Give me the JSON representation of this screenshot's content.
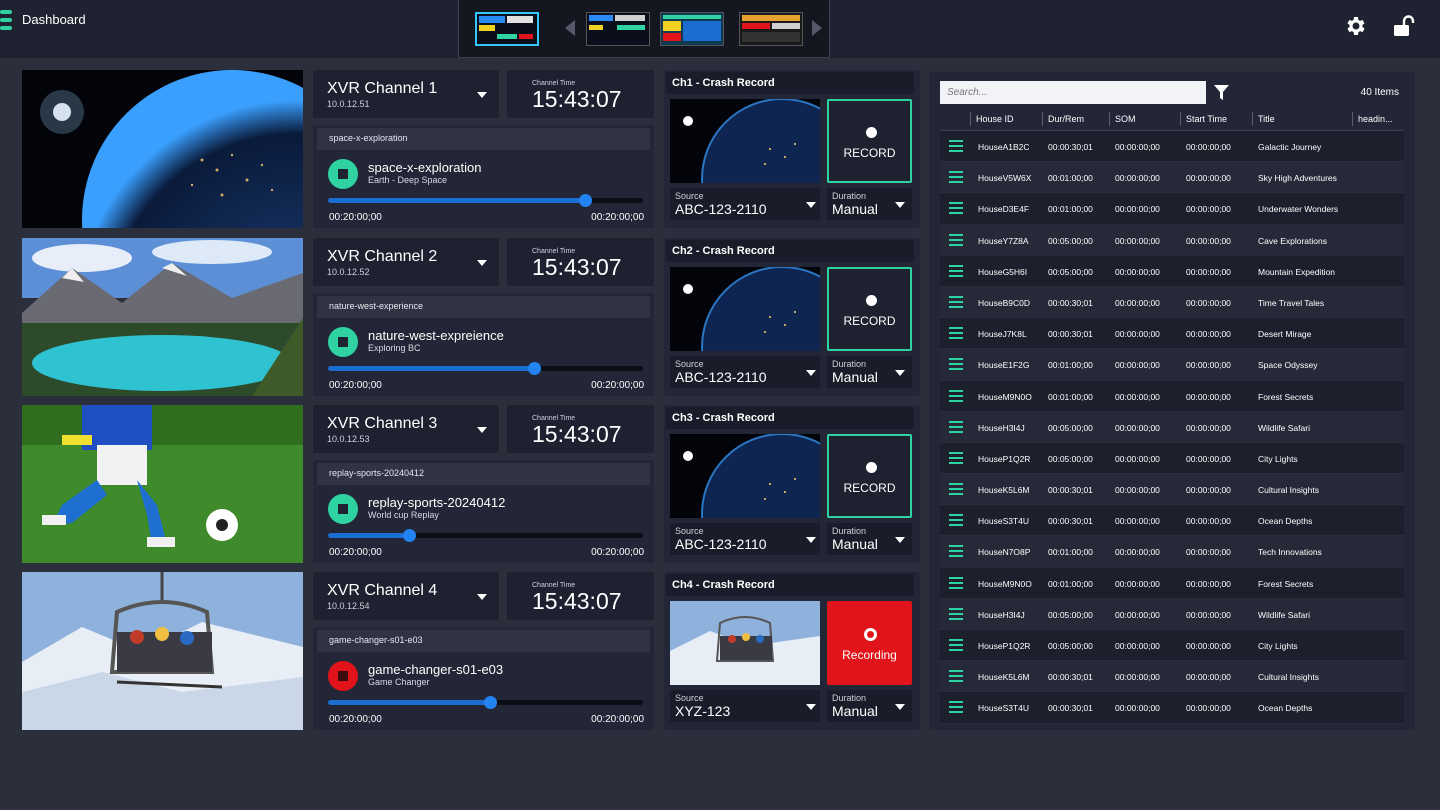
{
  "header": {
    "title": "Dashboard",
    "menu_icon": "hamburger-menu-icon",
    "settings_icon": "gear-icon",
    "lock_icon": "unlock-icon"
  },
  "colors": {
    "accent": "#2fd3a2",
    "record_red": "#e0141a",
    "progress_blue": "#1c6dd0",
    "background": "#2b2e3b"
  },
  "channels": [
    {
      "name": "XVR Channel 1",
      "ip": "10.0.12.51",
      "time_label": "Channel Time",
      "time": "15:43:07",
      "clip_tag": "space-x-exploration",
      "clip_title": "space-x-exploration",
      "clip_subtitle": "Earth - Deep Space",
      "progress": 0.815,
      "start": "00:20:00;00",
      "end": "00:20:00;00",
      "state": "ready",
      "rec_title": "Ch1 - Crash Record",
      "rec_label": "RECORD",
      "source_label": "Source",
      "source": "ABC-123-2110",
      "duration_label": "Duration",
      "duration": "Manual"
    },
    {
      "name": "XVR Channel 2",
      "ip": "10.0.12.52",
      "time_label": "Channel Time",
      "time": "15:43:07",
      "clip_tag": "nature-west-experience",
      "clip_title": "nature-west-expreience",
      "clip_subtitle": "Exploring BC",
      "progress": 0.655,
      "start": "00:20:00;00",
      "end": "00:20:00;00",
      "state": "ready",
      "rec_title": "Ch2 - Crash Record",
      "rec_label": "RECORD",
      "source_label": "Source",
      "source": "ABC-123-2110",
      "duration_label": "Duration",
      "duration": "Manual"
    },
    {
      "name": "XVR Channel 3",
      "ip": "10.0.12.53",
      "time_label": "Channel Time",
      "time": "15:43:07",
      "clip_tag": "replay-sports-20240412",
      "clip_title": "replay-sports-20240412",
      "clip_subtitle": "World cup Replay",
      "progress": 0.258,
      "start": "00:20:00;00",
      "end": "00:20:00;00",
      "state": "ready",
      "rec_title": "Ch3 - Crash Record",
      "rec_label": "RECORD",
      "source_label": "Source",
      "source": "ABC-123-2110",
      "duration_label": "Duration",
      "duration": "Manual"
    },
    {
      "name": "XVR Channel 4",
      "ip": "10.0.12.54",
      "time_label": "Channel Time",
      "time": "15:43:07",
      "clip_tag": "game-changer-s01-e03",
      "clip_title": "game-changer-s01-e03",
      "clip_subtitle": "Game Changer",
      "progress": 0.515,
      "start": "00:20:00;00",
      "end": "00:20:00;00",
      "state": "recording",
      "rec_title": "Ch4 - Crash Record",
      "rec_label": "Recording",
      "source_label": "Source",
      "source": "XYZ-123",
      "duration_label": "Duration",
      "duration": "Manual"
    }
  ],
  "list": {
    "search_placeholder": "Search...",
    "filter_icon": "filter-icon",
    "count": "40 Items",
    "columns": [
      "House ID",
      "Dur/Rem",
      "SOM",
      "Start Time",
      "Title",
      "headin..."
    ],
    "rows": [
      [
        "HouseA1B2C",
        "00:00:30;01",
        "00:00:00;00",
        "00:00:00;00",
        "Galactic Journey"
      ],
      [
        "HouseV5W6X",
        "00:01:00;00",
        "00:00:00;00",
        "00:00:00;00",
        "Sky High Adventures"
      ],
      [
        "HouseD3E4F",
        "00:01:00;00",
        "00:00:00;00",
        "00:00:00;00",
        "Underwater Wonders"
      ],
      [
        "HouseY7Z8A",
        "00:05:00;00",
        "00:00:00;00",
        "00:00:00;00",
        "Cave Explorations"
      ],
      [
        "HouseG5H6I",
        "00:05:00;00",
        "00:00:00;00",
        "00:00:00;00",
        "Mountain Expedition"
      ],
      [
        "HouseB9C0D",
        "00:00:30;01",
        "00:00:00;00",
        "00:00:00;00",
        "Time Travel Tales"
      ],
      [
        "HouseJ7K8L",
        "00:00:30;01",
        "00:00:00;00",
        "00:00:00;00",
        "Desert Mirage"
      ],
      [
        "HouseE1F2G",
        "00:01:00;00",
        "00:00:00;00",
        "00:00:00;00",
        "Space Odyssey"
      ],
      [
        "HouseM9N0O",
        "00:01:00;00",
        "00:00:00;00",
        "00:00:00;00",
        "Forest Secrets"
      ],
      [
        "HouseH3I4J",
        "00:05:00;00",
        "00:00:00;00",
        "00:00:00;00",
        "Wildlife Safari"
      ],
      [
        "HouseP1Q2R",
        "00:05:00;00",
        "00:00:00;00",
        "00:00:00;00",
        "City Lights"
      ],
      [
        "HouseK5L6M",
        "00:00:30;01",
        "00:00:00;00",
        "00:00:00;00",
        "Cultural Insights"
      ],
      [
        "HouseS3T4U",
        "00:00:30;01",
        "00:00:00;00",
        "00:00:00;00",
        "Ocean Depths"
      ],
      [
        "HouseN7O8P",
        "00:01:00;00",
        "00:00:00;00",
        "00:00:00;00",
        "Tech Innovations"
      ],
      [
        "HouseM9N0O",
        "00:01:00;00",
        "00:00:00;00",
        "00:00:00;00",
        "Forest Secrets"
      ],
      [
        "HouseH3I4J",
        "00:05:00;00",
        "00:00:00;00",
        "00:00:00;00",
        "Wildlife Safari"
      ],
      [
        "HouseP1Q2R",
        "00:05:00;00",
        "00:00:00;00",
        "00:00:00;00",
        "City Lights"
      ],
      [
        "HouseK5L6M",
        "00:00:30;01",
        "00:00:00;00",
        "00:00:00;00",
        "Cultural Insights"
      ],
      [
        "HouseS3T4U",
        "00:00:30;01",
        "00:00:00;00",
        "00:00:00;00",
        "Ocean Depths"
      ]
    ]
  }
}
